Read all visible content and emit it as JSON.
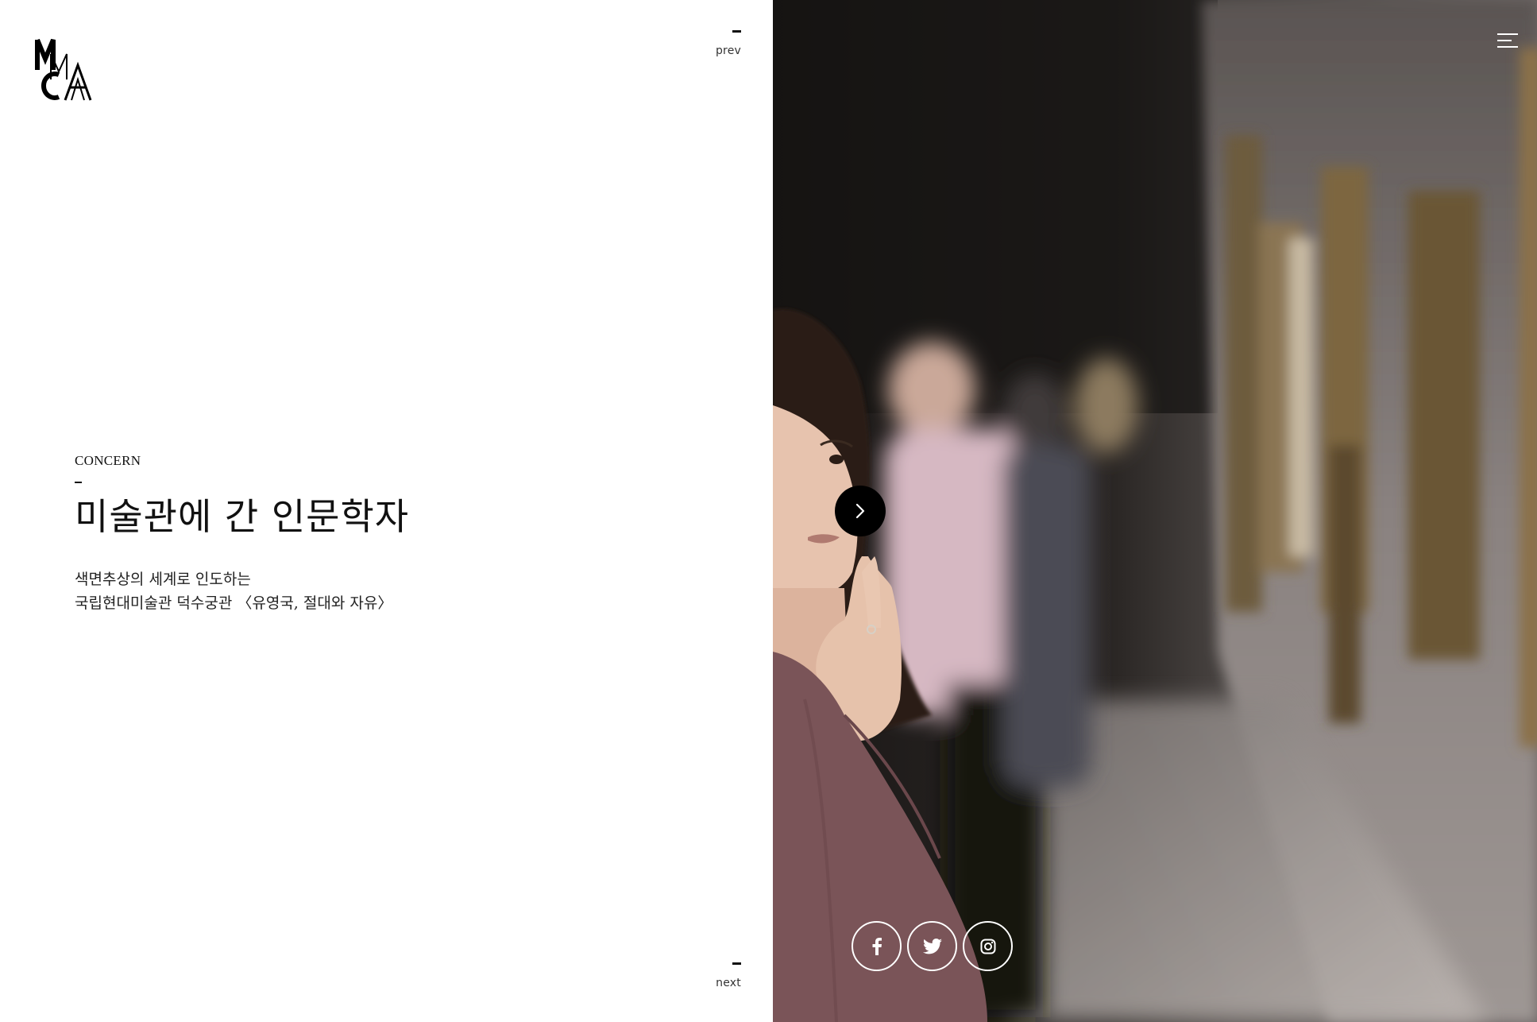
{
  "brand": {
    "logo_letters": "MMCA"
  },
  "nav": {
    "prev_label": "prev",
    "next_label": "next"
  },
  "article": {
    "category": "CONCERN",
    "title": "미술관에 간 인문학자",
    "description_lines": [
      "색면추상의 세계로 인도하는",
      "국립현대미술관 덕수궁관 〈유영국, 절대와 자유〉"
    ]
  },
  "icons": {
    "menu": "hamburger-menu-icon",
    "next_arrow": "chevron-right-icon",
    "facebook": "facebook-icon",
    "twitter": "twitter-icon",
    "instagram": "instagram-icon"
  },
  "colors": {
    "text": "#111111",
    "background": "#ffffff",
    "arrow_button": "#000000",
    "icon_on_photo": "#ffffff"
  }
}
